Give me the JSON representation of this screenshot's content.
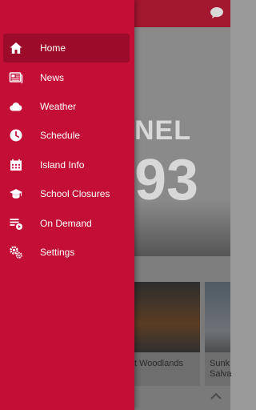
{
  "background": {
    "hero_logo_text": "NEL",
    "hero_logo_number": "93",
    "card1_title": "t Woodlands",
    "card2_title": "Sunk Salva"
  },
  "drawer": {
    "active_index": 0,
    "items": [
      {
        "label": "Home",
        "icon": "home-icon"
      },
      {
        "label": "News",
        "icon": "newspaper-icon"
      },
      {
        "label": "Weather",
        "icon": "cloud-icon"
      },
      {
        "label": "Schedule",
        "icon": "clock-icon"
      },
      {
        "label": "Island Info",
        "icon": "calendar-icon"
      },
      {
        "label": "School Closures",
        "icon": "graduation-cap-icon"
      },
      {
        "label": "On Demand",
        "icon": "playlist-play-icon"
      },
      {
        "label": "Settings",
        "icon": "gears-icon"
      }
    ]
  },
  "colors": {
    "drawer_bg": "#c30f35",
    "active_item_bg": "#9d0b2a",
    "topbar": "#a3172f"
  }
}
